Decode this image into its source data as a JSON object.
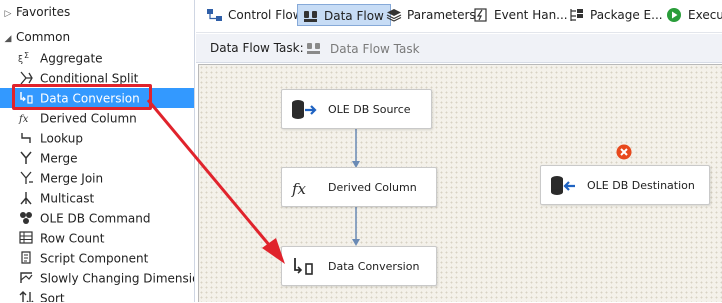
{
  "toolbox": {
    "groups": [
      {
        "label": "Favorites"
      },
      {
        "label": "Common"
      }
    ],
    "items": [
      {
        "label": "Aggregate",
        "icon": "aggregate-icon"
      },
      {
        "label": "Conditional Split",
        "icon": "conditional-split-icon"
      },
      {
        "label": "Data Conversion",
        "icon": "data-conversion-icon",
        "selected": true
      },
      {
        "label": "Derived Column",
        "icon": "derived-column-icon"
      },
      {
        "label": "Lookup",
        "icon": "lookup-icon"
      },
      {
        "label": "Merge",
        "icon": "merge-icon"
      },
      {
        "label": "Merge Join",
        "icon": "merge-join-icon"
      },
      {
        "label": "Multicast",
        "icon": "multicast-icon"
      },
      {
        "label": "OLE DB Command",
        "icon": "ole-db-command-icon"
      },
      {
        "label": "Row Count",
        "icon": "row-count-icon"
      },
      {
        "label": "Script Component",
        "icon": "script-component-icon"
      },
      {
        "label": "Slowly Changing Dimension",
        "icon": "slowly-changing-dimension-icon"
      },
      {
        "label": "Sort",
        "icon": "sort-icon"
      }
    ]
  },
  "tabs": [
    {
      "label": "Control Flow",
      "icon": "control-flow-icon"
    },
    {
      "label": "Data Flow",
      "icon": "data-flow-icon",
      "active": true
    },
    {
      "label": "Parameters",
      "icon": "parameters-icon"
    },
    {
      "label": "Event Han...",
      "icon": "event-handlers-icon"
    },
    {
      "label": "Package E...",
      "icon": "package-explorer-icon"
    },
    {
      "label": "Executi",
      "icon": "execution-icon"
    }
  ],
  "task_bar": {
    "label": "Data Flow Task:",
    "selected": "Data Flow Task"
  },
  "canvas": {
    "nodes": [
      {
        "id": "ole-db-source",
        "label": "OLE DB Source"
      },
      {
        "id": "derived-column",
        "label": "Derived Column"
      },
      {
        "id": "data-conversion",
        "label": "Data Conversion"
      },
      {
        "id": "ole-db-destination",
        "label": "OLE DB Destination",
        "error": true
      }
    ]
  },
  "colors": {
    "accent": "#3399ff",
    "annotation_red": "#e0232c",
    "canvas_bg": "#f4f1ea",
    "connector": "#6a8ab5",
    "error": "#e8481c"
  }
}
